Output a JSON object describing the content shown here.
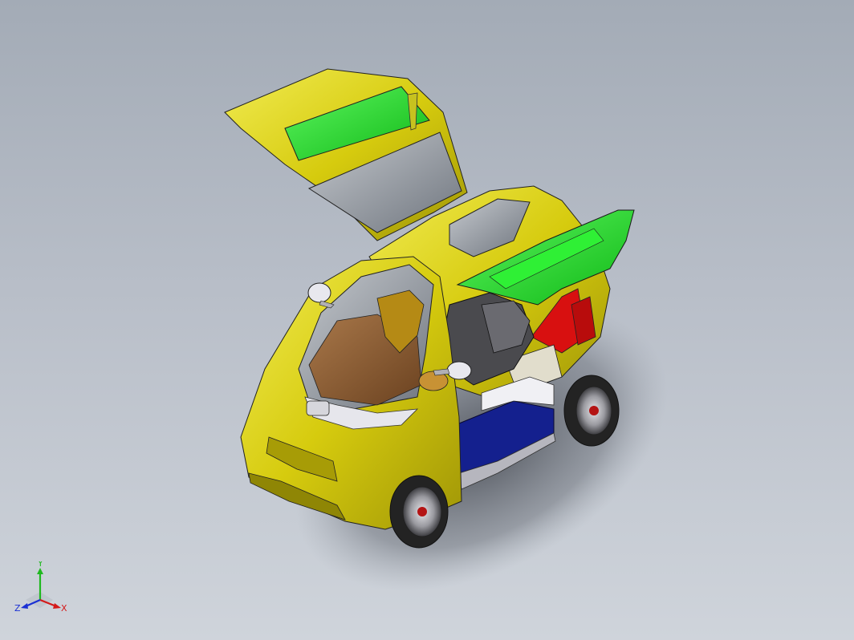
{
  "viewport": {
    "background_top": "#a3abb6",
    "background_bottom": "#cfd4db"
  },
  "model": {
    "colors": {
      "body": "#d9cf10",
      "body_shade": "#a79c06",
      "body_highlight": "#f4ee63",
      "panel_highlight": "#22e22a",
      "glass": "#9aa0a8",
      "dashboard": "#8a5a2c",
      "battery": "#14208e",
      "seat": "#4a4a4e",
      "interior_red": "#d81010",
      "tire": "#2a2a2a",
      "rim": "#c8c8cc"
    }
  },
  "triad": {
    "labels": {
      "x": "X",
      "y": "Y",
      "z": "Z"
    },
    "colors": {
      "x": "#d41a1a",
      "y": "#1fb81f",
      "z": "#1a30d4"
    }
  }
}
